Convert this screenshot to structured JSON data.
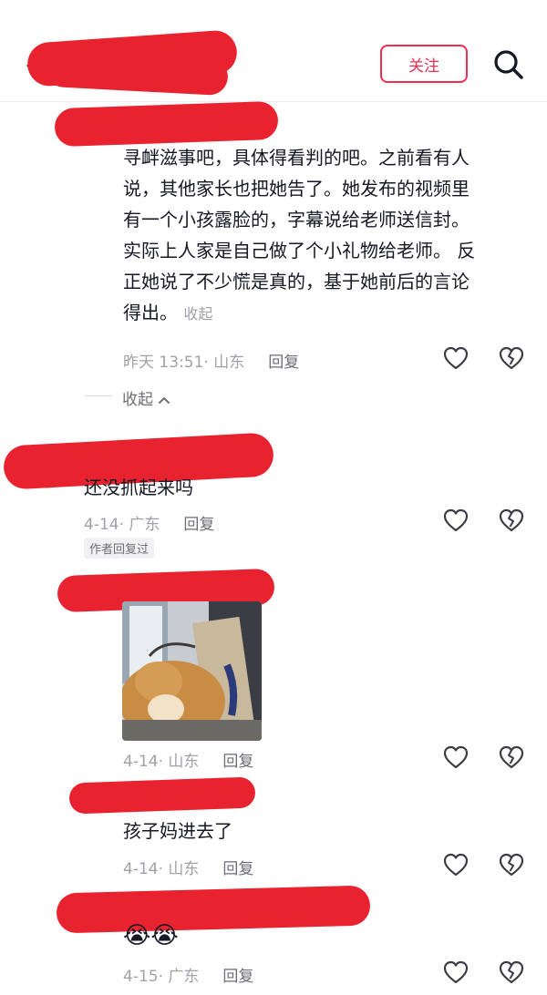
{
  "header": {
    "follow_label": "关注"
  },
  "comments": [
    {
      "text": "寻衅滋事吧，具体得看判的吧。之前看有人说，其他家长也把她告了。她发布的视频里有一个小孩露脸的，字幕说给老师送信封。实际上人家是自己做了个小礼物给老师。 反正她说了不少慌是真的，基于她前后的言论得出。",
      "lines": [
        "寻衅滋事吧，具体得看判的吧。之前看有人",
        "说，其他家长也把她告了。她发布的视频里",
        "有一个小孩露脸的，字幕说给老师送信封。",
        "实际上人家是自己做了个小礼物给老师。 反",
        "正她说了不少慌是真的，基于她前后的言论",
        "得出。"
      ],
      "collapse_inline": "收起",
      "time_location": "昨天 13:51· 山东",
      "reply_label": "回复"
    },
    {
      "text": "还没抓起来吗",
      "time_location": "4-14· 广东",
      "reply_label": "回复",
      "author_badge": "作者回复过"
    },
    {
      "time_location": "4-14· 山东",
      "reply_label": "回复"
    },
    {
      "text": "孩子妈进去了",
      "time_location": "4-14· 山东",
      "reply_label": "回复"
    },
    {
      "text": "😭😭",
      "time_location": "4-15· 广东",
      "reply_label": "回复"
    }
  ],
  "fold": {
    "label": "收起"
  },
  "icons": {
    "back": "chevron-left-icon",
    "search": "search-icon",
    "like": "heart-icon",
    "dislike": "broken-heart-icon",
    "fold_arrow": "chevron-up-icon"
  },
  "colors": {
    "accent": "#ee2d52",
    "redaction": "#e8222e",
    "muted": "#a0a2a8"
  }
}
